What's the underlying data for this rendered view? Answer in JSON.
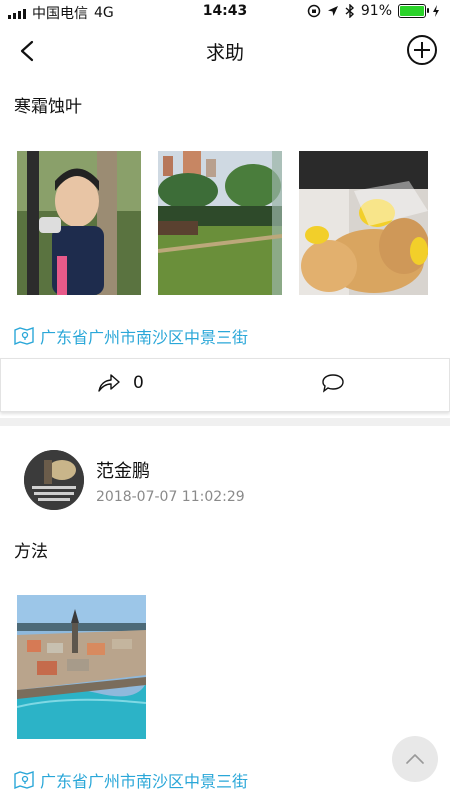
{
  "status_bar": {
    "carrier": "中国电信",
    "network": "4G",
    "time": "14:43",
    "battery_level": 0.91,
    "battery_text": "91%"
  },
  "nav": {
    "title": "求助",
    "back_icon": "back-chevron-icon",
    "add_icon": "add-circle-icon"
  },
  "posts": [
    {
      "text": "寒霜蚀叶",
      "images": [
        "child-photo",
        "garden-photo",
        "pastry-photo"
      ],
      "location": "广东省广州市南沙区中景三街",
      "share_count": "0"
    },
    {
      "author": "范金鹏",
      "timestamp": "2018-07-07 11:02:29",
      "text": "方法",
      "images": [
        "city-river-photo"
      ],
      "location": "广东省广州市南沙区中景三街"
    }
  ],
  "colors": {
    "accent": "#2aa7d8",
    "battery": "#2bd32a",
    "separator": "#f0f0f0"
  }
}
